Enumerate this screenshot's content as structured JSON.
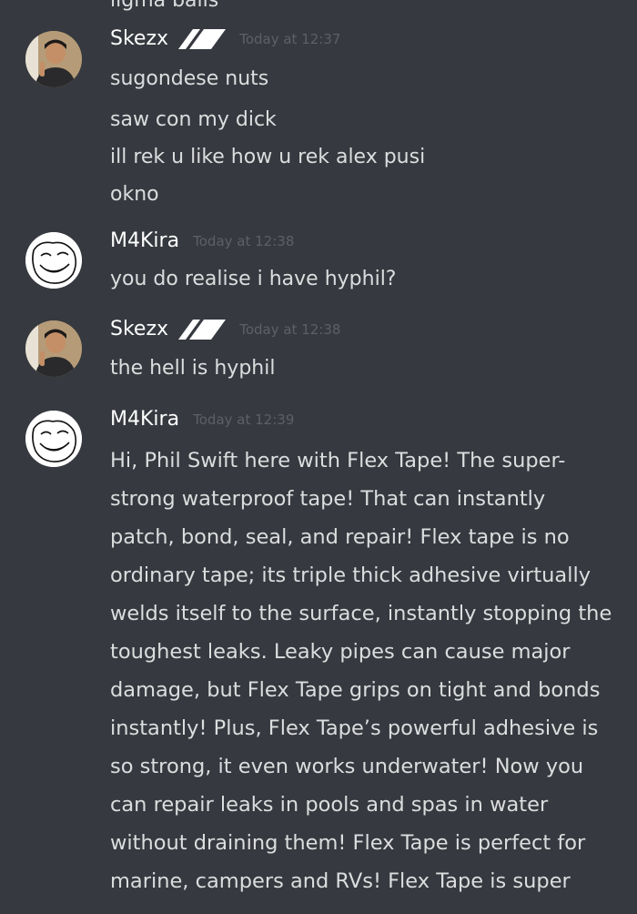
{
  "clipped_top_text": "ligma balls",
  "messages": [
    {
      "username": "Skezx",
      "avatar": "user-photo",
      "timestamp": "Today at 12:37",
      "lines": [
        "sugondese nuts",
        "saw con my dick",
        "ill rek u like how u rek alex pusi",
        "okno"
      ]
    },
    {
      "username": "M4Kira",
      "avatar": "trollface",
      "timestamp": "Today at 12:38",
      "lines": [
        "you do realise i have hyphil?"
      ]
    },
    {
      "username": "Skezx",
      "avatar": "user-photo",
      "timestamp": "Today at 12:38",
      "lines": [
        "the hell is hyphil"
      ]
    },
    {
      "username": "M4Kira",
      "avatar": "trollface",
      "timestamp": "Today at 12:39",
      "lines": [
        "Hi, Phil Swift here with Flex Tape! The super-",
        "strong waterproof tape! That can instantly",
        "patch, bond, seal, and repair! Flex tape is no",
        "ordinary tape; its triple thick adhesive virtually",
        "welds itself to the surface, instantly stopping the",
        "toughest leaks. Leaky pipes can cause major",
        "damage, but Flex Tape grips on tight and bonds",
        "instantly! Plus, Flex Tape’s powerful adhesive is",
        "so strong, it even works underwater! Now you",
        "can repair leaks in pools and spas in water",
        "without draining them! Flex Tape is perfect for",
        "marine, campers and RVs! Flex Tape is super"
      ]
    }
  ],
  "colors": {
    "background": "#36393f",
    "text": "#dcddde",
    "username": "#ffffff",
    "timestamp": "#5d6067"
  }
}
